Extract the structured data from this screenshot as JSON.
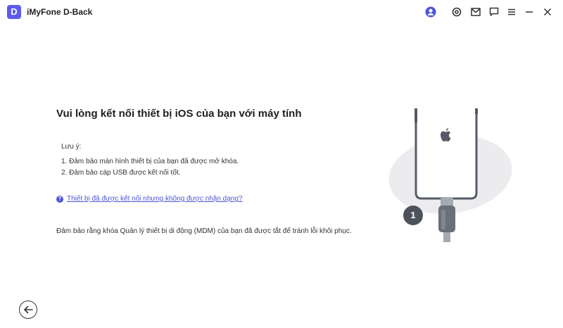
{
  "app": {
    "logo_letter": "D",
    "title": "iMyFone D-Back"
  },
  "titlebar_icons": [
    "user-icon",
    "settings-icon",
    "mail-icon",
    "feedback-icon",
    "menu-icon",
    "minimize-icon",
    "close-icon"
  ],
  "main": {
    "heading": "Vui lòng kết nối thiết bị iOS của bạn với máy tính",
    "note_title": "Lưu ý:",
    "notes": [
      "1. Đảm bảo màn hình thiết bị của bạn đã được mở khóa.",
      "2. Đảm bảo cáp USB được kết nối tốt."
    ],
    "help_link": "Thiết bị đã được kết nối nhưng không được nhận dạng?",
    "mdm_note": "Đảm bảo rằng khóa Quản lý thiết bị di động (MDM) của bạn đã được tắt để tránh lỗi khôi phục."
  },
  "illustration": {
    "step_number": "1",
    "device_icon": "apple-icon"
  },
  "colors": {
    "accent": "#5b5bf0",
    "link": "#4a55d6",
    "text": "#222222"
  }
}
